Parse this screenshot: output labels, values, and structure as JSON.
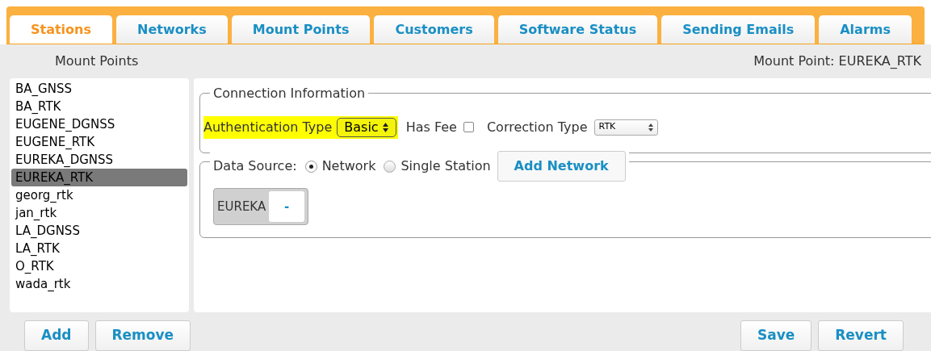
{
  "tabs": [
    {
      "label": "Stations",
      "selected": true
    },
    {
      "label": "Networks",
      "selected": false
    },
    {
      "label": "Mount Points",
      "selected": false
    },
    {
      "label": "Customers",
      "selected": false
    },
    {
      "label": "Software Status",
      "selected": false
    },
    {
      "label": "Sending Emails",
      "selected": false
    },
    {
      "label": "Alarms",
      "selected": false
    }
  ],
  "header": {
    "left": "Mount Points",
    "right": "Mount Point: EUREKA_RTK"
  },
  "mount_points": [
    {
      "label": "BA_GNSS",
      "selected": false
    },
    {
      "label": "BA_RTK",
      "selected": false
    },
    {
      "label": "EUGENE_DGNSS",
      "selected": false
    },
    {
      "label": "EUGENE_RTK",
      "selected": false
    },
    {
      "label": "EUREKA_DGNSS",
      "selected": false
    },
    {
      "label": "EUREKA_RTK",
      "selected": true
    },
    {
      "label": "georg_rtk",
      "selected": false
    },
    {
      "label": "jan_rtk",
      "selected": false
    },
    {
      "label": "LA_DGNSS",
      "selected": false
    },
    {
      "label": "LA_RTK",
      "selected": false
    },
    {
      "label": "O_RTK",
      "selected": false
    },
    {
      "label": "wada_rtk",
      "selected": false
    }
  ],
  "connection_information": {
    "legend": "Connection Information",
    "authentication_label": "Authentication Type",
    "authentication_value": "Basic",
    "highlighted": true,
    "has_fee_label": "Has Fee",
    "has_fee_checked": false,
    "correction_label": "Correction Type",
    "correction_value": "RTK"
  },
  "data_source": {
    "label": "Data Source:",
    "options": [
      {
        "label": "Network",
        "selected": true
      },
      {
        "label": "Single Station",
        "selected": false
      }
    ],
    "add_button": "Add Network",
    "networks": [
      {
        "name": "EUREKA",
        "remove": "-"
      }
    ]
  },
  "left_buttons": [
    "Add",
    "Remove"
  ],
  "right_buttons": [
    "Save",
    "Revert"
  ]
}
